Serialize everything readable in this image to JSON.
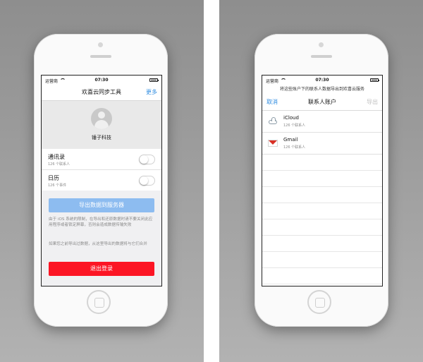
{
  "left_phone": {
    "status": {
      "carrier": "运营商",
      "time": "07:30"
    },
    "nav": {
      "title": "欢喜云同步工具",
      "right": "更多"
    },
    "profile": {
      "name": "锤子科技"
    },
    "rows": [
      {
        "label": "通讯录",
        "sub": "126 个联系人",
        "toggle_on": false
      },
      {
        "label": "日历",
        "sub": "126 个事件",
        "toggle_on": false
      }
    ],
    "export_button": "导出数据到服务器",
    "note1": "由于 iOS 系统的限制，在导出和还原数据时请不要关闭此应用程序或者锁定屏幕，否则会造成数据传输失败",
    "note2": "如果您之前导出过数据，从这里导出的数据将与它们合并",
    "logout_button": "退出登录"
  },
  "right_phone": {
    "status": {
      "carrier": "运营商",
      "time": "07:30"
    },
    "prompt": "将这些账户下的联系人数据导出到欢喜云服务",
    "nav": {
      "left": "取消",
      "title": "联系人账户",
      "right": "导出"
    },
    "accounts": [
      {
        "label": "iCloud",
        "sub": "126 个联系人",
        "icon": "cloud-icon"
      },
      {
        "label": "Gmail",
        "sub": "126 个联系人",
        "icon": "gmail-icon"
      }
    ]
  },
  "colors": {
    "accent": "#2f8ce0",
    "export_button": "#8dbcf0",
    "logout_button": "#fc1524",
    "background_gray": "#9e9e9e"
  }
}
